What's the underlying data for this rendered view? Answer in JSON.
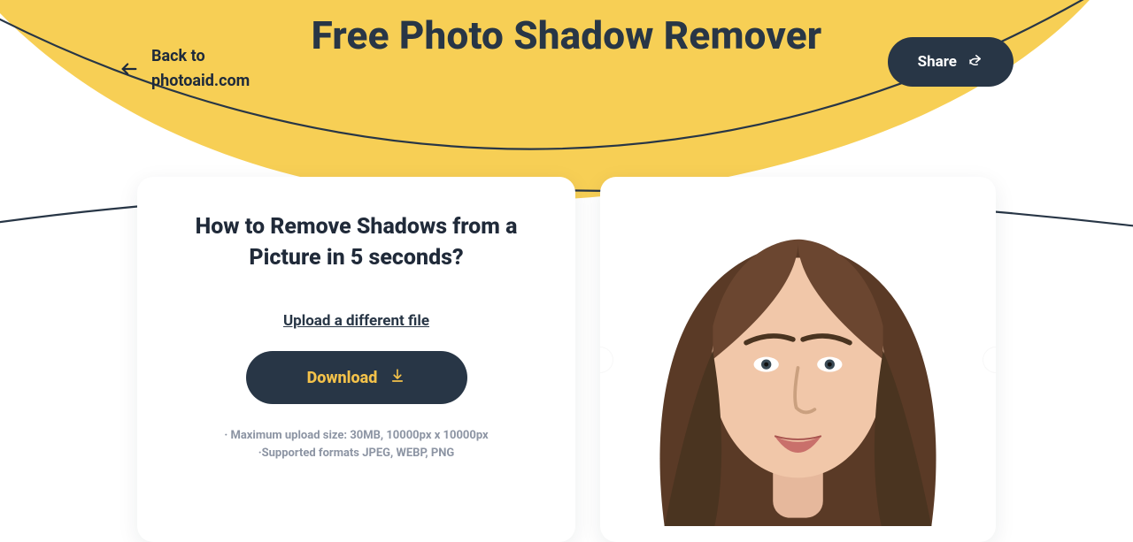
{
  "header": {
    "back_label_line1": "Back to",
    "back_label_line2": "photoaid.com",
    "title": "Free Photo Shadow Remover",
    "share_label": "Share"
  },
  "left_card": {
    "heading": "How to Remove Shadows from a Picture in 5 seconds?",
    "upload_different": "Upload a different file",
    "download_label": "Download",
    "note_line1": "· Maximum upload size: 30MB, 10000px x 10000px",
    "note_line2": "·Supported formats JPEG, WEBP, PNG"
  },
  "colors": {
    "yellow": "#f7cf55",
    "navy": "#283646",
    "accent_yellow_text": "#f4c24a"
  }
}
